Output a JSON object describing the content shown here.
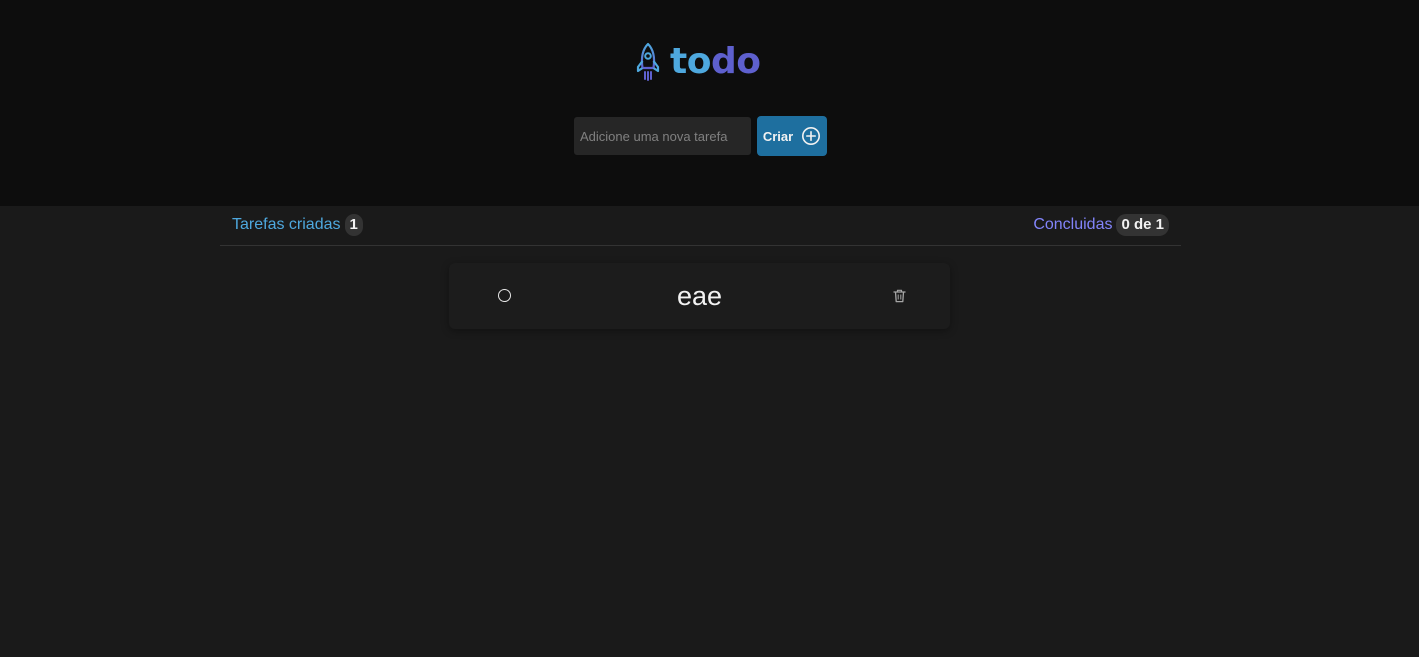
{
  "app": {
    "logo_part1": "to",
    "logo_part2": "do"
  },
  "new_task": {
    "placeholder": "Adicione uma nova tarefa",
    "value": "",
    "create_label": "Criar"
  },
  "stats": {
    "created_label": "Tarefas criadas",
    "created_count": "1",
    "done_label": "Concluidas",
    "done_count": "0 de 1"
  },
  "tasks": [
    {
      "text": "eae",
      "completed": false
    }
  ],
  "icons": {
    "logo": "rocket-icon",
    "create": "plus-circle-icon",
    "task_check": "circle-checkbox-icon",
    "task_delete": "trash-icon"
  },
  "colors": {
    "header_bg": "#0d0d0d",
    "page_bg": "#1a1a1a",
    "brand_blue": "#4ea8de",
    "brand_purple": "#5e60ce",
    "done_purple": "#8284fa",
    "button_blue": "#1e6f9f"
  }
}
